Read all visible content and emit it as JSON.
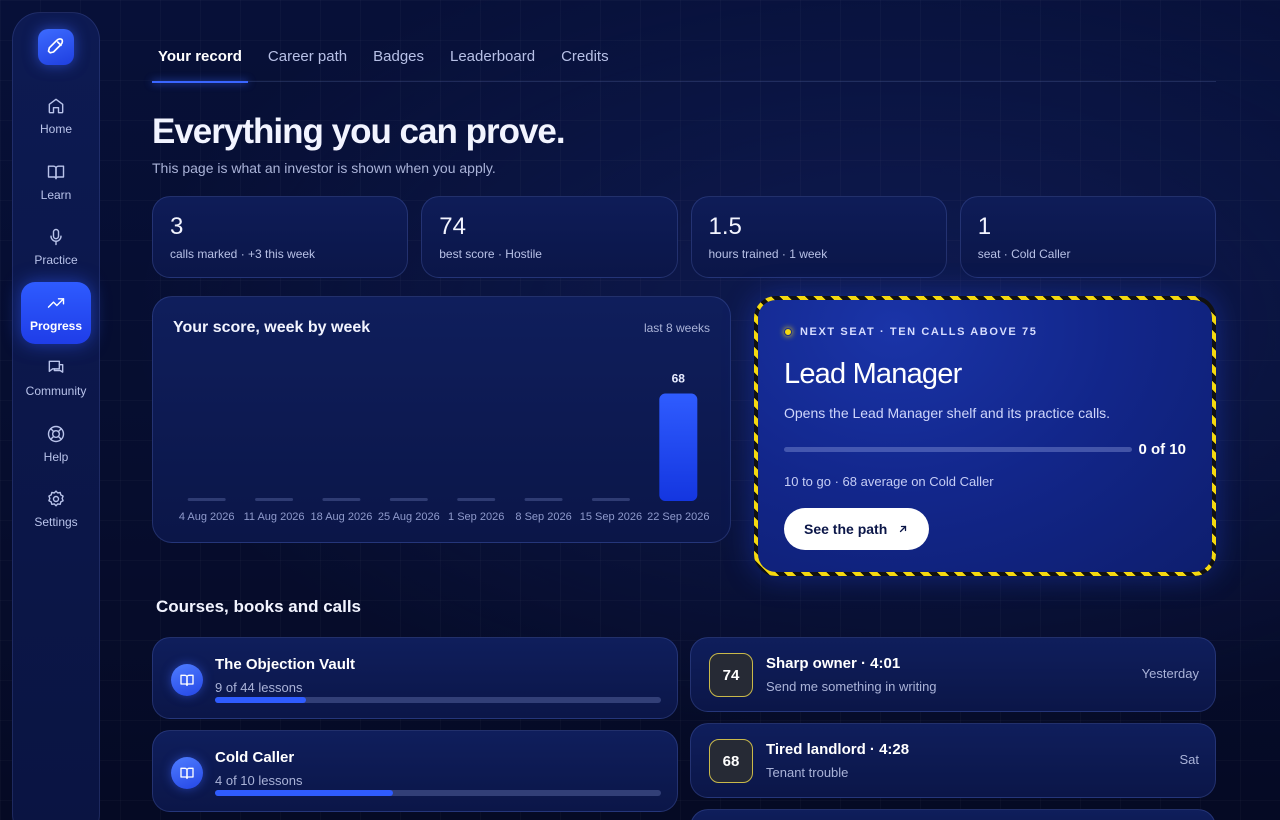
{
  "sidebar": {
    "items": [
      {
        "label": "Home",
        "icon": "home-icon"
      },
      {
        "label": "Learn",
        "icon": "book-icon"
      },
      {
        "label": "Practice",
        "icon": "mic-icon"
      },
      {
        "label": "Progress",
        "icon": "trend-up-icon",
        "active": true
      },
      {
        "label": "Community",
        "icon": "chat-icon"
      },
      {
        "label": "Help",
        "icon": "lifebuoy-icon"
      },
      {
        "label": "Settings",
        "icon": "gear-icon"
      }
    ]
  },
  "tabs": [
    "Your record",
    "Career path",
    "Badges",
    "Leaderboard",
    "Credits"
  ],
  "page": {
    "title": "Everything you can prove.",
    "subtitle": "This page is what an investor is shown when you apply."
  },
  "stats": [
    {
      "value": "3",
      "label": "calls marked · +3 this week"
    },
    {
      "value": "74",
      "label": "best score · Hostile"
    },
    {
      "value": "1.5",
      "label": "hours trained · 1 week"
    },
    {
      "value": "1",
      "label": "seat · Cold Caller"
    }
  ],
  "chart": {
    "title": "Your score, week by week",
    "range": "last 8 weeks"
  },
  "chart_data": {
    "type": "bar",
    "categories": [
      "4 Aug 2026",
      "11 Aug 2026",
      "18 Aug 2026",
      "25 Aug 2026",
      "1 Sep 2026",
      "8 Sep 2026",
      "15 Sep 2026",
      "22 Sep 2026"
    ],
    "values": [
      0,
      0,
      0,
      0,
      0,
      0,
      0,
      68
    ],
    "data_labels": [
      "",
      "",
      "",
      "",
      "",
      "",
      "",
      "68"
    ],
    "ylim": [
      0,
      100
    ],
    "grid": false,
    "bar_color": "#2f5cff"
  },
  "next_seat": {
    "eyebrow": "NEXT SEAT · TEN CALLS ABOVE 75",
    "title": "Lead Manager",
    "description": "Opens the Lead Manager shelf and its practice calls.",
    "progress": 0,
    "progress_label": "0 of 10",
    "meta": "10 to go · 68 average on Cold Caller",
    "button_label": "See the path",
    "accent": "#f5d90f"
  },
  "section": {
    "title": "Courses, books and calls"
  },
  "courses": [
    {
      "name": "The Objection Vault",
      "progress_label": "9 of 44 lessons",
      "progress": 0.2045
    },
    {
      "name": "Cold Caller",
      "progress_label": "4 of 10 lessons",
      "progress": 0.4
    }
  ],
  "calls": [
    {
      "score": "74",
      "title": "Sharp owner · 4:01",
      "subtitle": "Send me something in writing",
      "when": "Yesterday"
    },
    {
      "score": "68",
      "title": "Tired landlord · 4:28",
      "subtitle": "Tenant trouble",
      "when": "Sat"
    }
  ],
  "colors": {
    "accent_blue": "#2f5cff",
    "score_border": "#c9b94a",
    "background": "#060d2e"
  }
}
